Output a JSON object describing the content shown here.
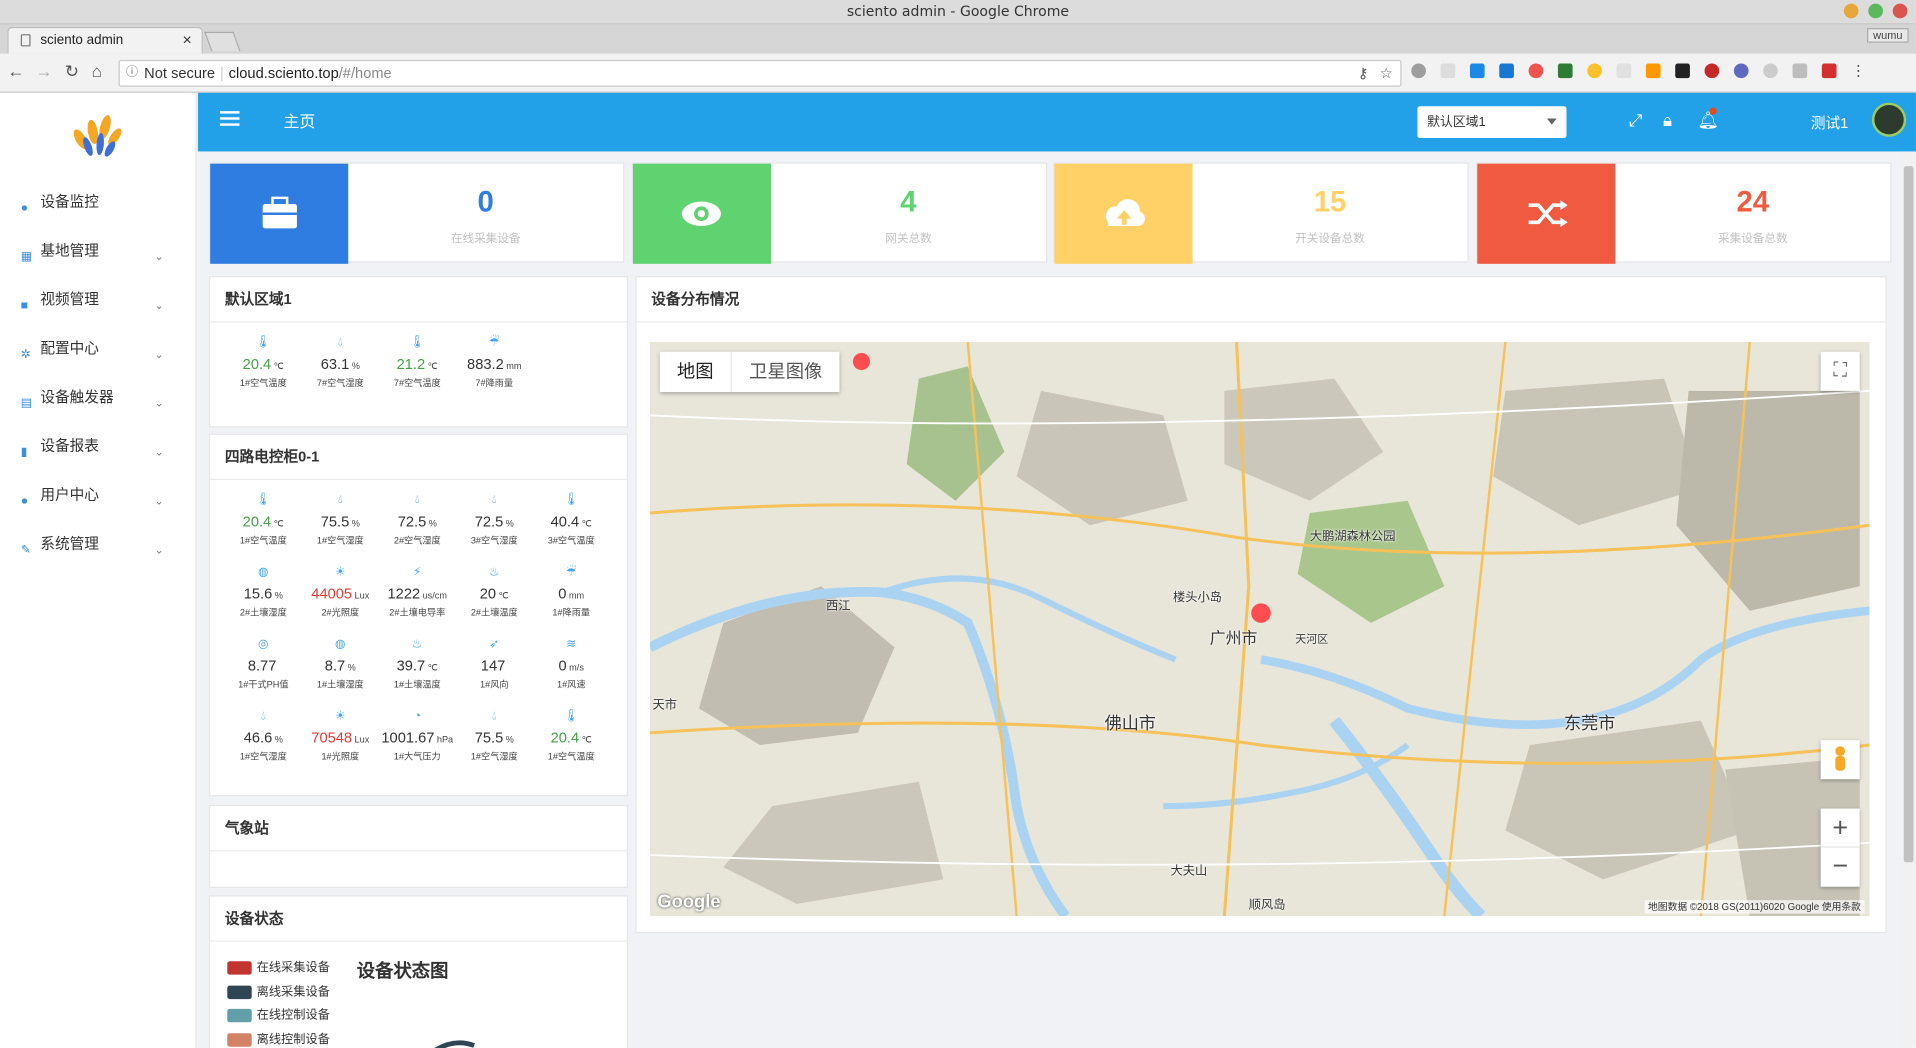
{
  "browser": {
    "window_title": "sciento admin - Google Chrome",
    "tab_title": "sciento admin",
    "tab_close": "×",
    "profile": "wumu",
    "security": "Not secure",
    "url_host": "cloud.sciento.top",
    "url_path": "/#/home"
  },
  "sidebar": {
    "items": [
      {
        "label": "设备监控",
        "icon": "eye-icon"
      },
      {
        "label": "基地管理",
        "icon": "grid-icon"
      },
      {
        "label": "视频管理",
        "icon": "video-icon"
      },
      {
        "label": "配置中心",
        "icon": "gear-icon"
      },
      {
        "label": "设备触发器",
        "icon": "list-icon"
      },
      {
        "label": "设备报表",
        "icon": "book-icon"
      },
      {
        "label": "用户中心",
        "icon": "user-icon"
      },
      {
        "label": "系统管理",
        "icon": "wrench-icon"
      }
    ]
  },
  "header": {
    "title": "主页",
    "region_select": "默认区域1",
    "user": "测试1"
  },
  "stats": [
    {
      "value": "0",
      "label": "在线采集设备",
      "color": "#2f7de1",
      "icon": "briefcase-icon"
    },
    {
      "value": "4",
      "label": "网关总数",
      "color": "#5fd36f",
      "icon": "eye-icon"
    },
    {
      "value": "15",
      "label": "开关设备总数",
      "color": "#ffd166",
      "icon": "cloud-upload-icon"
    },
    {
      "value": "24",
      "label": "采集设备总数",
      "color": "#f05a40",
      "icon": "shuffle-icon"
    }
  ],
  "region1": {
    "title": "默认区域1",
    "sensors": [
      {
        "value": "20.4",
        "unit": "℃",
        "label": "1#空气温度",
        "tone": "g",
        "icon": "thermometer-icon"
      },
      {
        "value": "63.1",
        "unit": "%",
        "label": "7#空气湿度",
        "tone": "",
        "icon": "drop-icon"
      },
      {
        "value": "21.2",
        "unit": "℃",
        "label": "7#空气温度",
        "tone": "g",
        "icon": "thermometer-icon"
      },
      {
        "value": "883.2",
        "unit": "mm",
        "label": "7#降雨量",
        "tone": "",
        "icon": "rain-icon"
      }
    ]
  },
  "cabinet": {
    "title": "四路电控柜0-1",
    "sensors": [
      {
        "value": "20.4",
        "unit": "℃",
        "label": "1#空气温度",
        "tone": "g",
        "icon": "thermometer-icon"
      },
      {
        "value": "75.5",
        "unit": "%",
        "label": "1#空气湿度",
        "tone": "",
        "icon": "drop-icon"
      },
      {
        "value": "72.5",
        "unit": "%",
        "label": "2#空气湿度",
        "tone": "",
        "icon": "drop-icon"
      },
      {
        "value": "72.5",
        "unit": "%",
        "label": "3#空气湿度",
        "tone": "",
        "icon": "drop-icon"
      },
      {
        "value": "40.4",
        "unit": "℃",
        "label": "3#空气温度",
        "tone": "",
        "icon": "thermometer-icon"
      },
      {
        "value": "15.6",
        "unit": "%",
        "label": "2#土壤湿度",
        "tone": "",
        "icon": "soil-icon"
      },
      {
        "value": "44005",
        "unit": "Lux",
        "label": "2#光照度",
        "tone": "r",
        "icon": "sun-icon"
      },
      {
        "value": "1222",
        "unit": "us/cm",
        "label": "2#土壤电导率",
        "tone": "",
        "icon": "bolt-icon"
      },
      {
        "value": "20",
        "unit": "℃",
        "label": "2#土壤温度",
        "tone": "",
        "icon": "soil-temp-icon"
      },
      {
        "value": "0",
        "unit": "mm",
        "label": "1#降雨量",
        "tone": "",
        "icon": "rain-icon"
      },
      {
        "value": "8.77",
        "unit": "",
        "label": "1#干式PH值",
        "tone": "",
        "icon": "ph-icon"
      },
      {
        "value": "8.7",
        "unit": "%",
        "label": "1#土壤湿度",
        "tone": "",
        "icon": "soil-icon"
      },
      {
        "value": "39.7",
        "unit": "℃",
        "label": "1#土壤温度",
        "tone": "",
        "icon": "soil-temp-icon"
      },
      {
        "value": "147",
        "unit": "",
        "label": "1#风向",
        "tone": "",
        "icon": "wind-direction-icon"
      },
      {
        "value": "0",
        "unit": "m/s",
        "label": "1#风速",
        "tone": "",
        "icon": "wind-speed-icon"
      },
      {
        "value": "46.6",
        "unit": "%",
        "label": "1#空气湿度",
        "tone": "",
        "icon": "drop-icon"
      },
      {
        "value": "70548",
        "unit": "Lux",
        "label": "1#光照度",
        "tone": "r",
        "icon": "sun-icon"
      },
      {
        "value": "1001.67",
        "unit": "hPa",
        "label": "1#大气压力",
        "tone": "",
        "icon": "gauge-icon"
      },
      {
        "value": "75.5",
        "unit": "%",
        "label": "1#空气湿度",
        "tone": "",
        "icon": "drop-icon"
      },
      {
        "value": "20.4",
        "unit": "℃",
        "label": "1#空气温度",
        "tone": "g",
        "icon": "thermometer-icon"
      }
    ]
  },
  "weather": {
    "title": "气象站"
  },
  "device_status": {
    "title": "设备状态",
    "chart_title": "设备状态图",
    "legend": [
      {
        "label": "在线采集设备",
        "color": "#c23531"
      },
      {
        "label": "离线采集设备",
        "color": "#2f4554"
      },
      {
        "label": "在线控制设备",
        "color": "#61a0a8"
      },
      {
        "label": "离线控制设备",
        "color": "#d48265"
      }
    ]
  },
  "map_panel": {
    "title": "设备分布情况",
    "tab_map": "地图",
    "tab_satellite": "卫星图像",
    "google": "Google",
    "footer": "地图数据 ©2018 GS(2011)6020 Google   使用条款",
    "zoom_in": "+",
    "zoom_out": "−",
    "places": [
      {
        "name": "佛山市"
      },
      {
        "name": "广州市"
      },
      {
        "name": "东莞市"
      },
      {
        "name": "大夫山"
      },
      {
        "name": "楼头小岛"
      },
      {
        "name": "天河区"
      },
      {
        "name": "大鹏湖森林公园"
      },
      {
        "name": "顺风岛"
      },
      {
        "name": "西江"
      },
      {
        "name": "天市"
      }
    ]
  }
}
